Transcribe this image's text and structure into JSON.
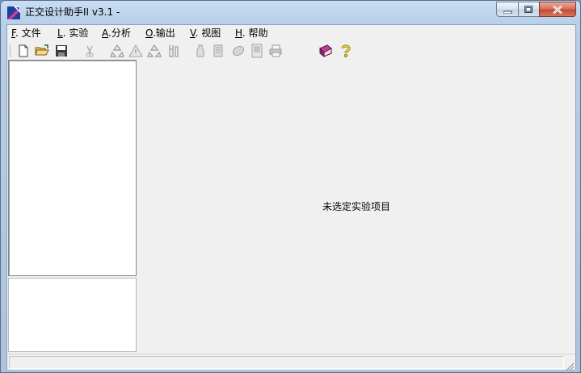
{
  "window": {
    "title": "正交设计助手II v3.1 -",
    "buttons": {
      "minimize": "minimize-icon",
      "maximize": "maximize-icon",
      "close": "close-icon"
    }
  },
  "menu": {
    "file": {
      "key": "F",
      "label": ". 文件"
    },
    "experiment": {
      "key": "L",
      "label": ". 实验"
    },
    "analysis": {
      "key": "A",
      "label": ".分析"
    },
    "output": {
      "key": "O",
      "label": ".输出"
    },
    "view": {
      "key": "V",
      "label": ". 视图"
    },
    "help": {
      "key": "H",
      "label": ". 帮助"
    }
  },
  "toolbar": {
    "icons": [
      "new-file-icon",
      "open-folder-icon",
      "save-icon",
      "cut-icon",
      "recycle-icon",
      "warning-icon",
      "recycle-icon",
      "wrench-icon",
      "bottle-icon",
      "document-icon",
      "oval-icon",
      "page-icon",
      "printer-icon",
      "book-icon",
      "help-icon"
    ]
  },
  "main": {
    "message": "未选定实验项目"
  },
  "colors": {
    "titlebar": "#b7cfe9",
    "client_bg": "#f0f0f0",
    "panel_bg": "#ffffff",
    "close_button": "#c64a33"
  }
}
